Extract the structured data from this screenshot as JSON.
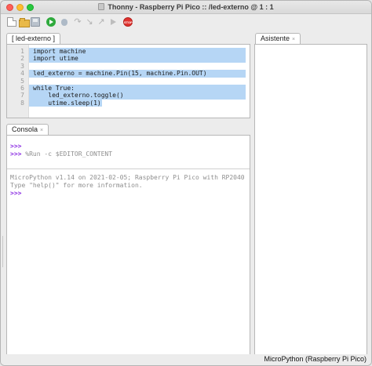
{
  "window": {
    "title": "Thonny  -  Raspberry Pi Pico :: /led-externo  @  1 : 1"
  },
  "toolbar": {
    "buttons": [
      {
        "name": "new",
        "icon": "new-file-icon"
      },
      {
        "name": "open",
        "icon": "open-folder-icon"
      },
      {
        "name": "save",
        "icon": "save-icon"
      },
      {
        "name": "run",
        "icon": "run-icon"
      },
      {
        "name": "debug",
        "icon": "debug-icon"
      },
      {
        "name": "step_over",
        "icon": "step-over-icon",
        "glyph": "↷"
      },
      {
        "name": "step_into",
        "icon": "step-into-icon",
        "glyph": "↘"
      },
      {
        "name": "step_out",
        "icon": "step-out-icon",
        "glyph": "↗"
      },
      {
        "name": "resume",
        "icon": "resume-icon"
      },
      {
        "name": "stop",
        "icon": "stop-icon"
      }
    ]
  },
  "editor": {
    "tab_label": "[ led-externo ]",
    "lines": [
      {
        "n": "1",
        "text": "import machine"
      },
      {
        "n": "2",
        "text": "import utime"
      },
      {
        "n": "3",
        "text": ""
      },
      {
        "n": "4",
        "text": "led_externo = machine.Pin(15, machine.Pin.OUT)"
      },
      {
        "n": "5",
        "text": ""
      },
      {
        "n": "6",
        "text": "while True:"
      },
      {
        "n": "7",
        "text": "    led_externo.toggle()"
      },
      {
        "n": "8",
        "text": "    utime.sleep(1)"
      }
    ]
  },
  "shell": {
    "tab_label": "Consola",
    "close_glyph": "×",
    "prompt": ">>>",
    "run_command": " %Run -c $EDITOR_CONTENT",
    "banner_line1": "MicroPython v1.14 on 2021-02-05; Raspberry Pi Pico with RP2040",
    "banner_line2": "Type \"help()\" for more information."
  },
  "assistant": {
    "tab_label": "Asistente",
    "close_glyph": "×"
  },
  "status": {
    "interpreter": "MicroPython (Raspberry Pi Pico)"
  },
  "colors": {
    "selection": "#b6d6f5",
    "prompt": "#8a2be2",
    "run_button": "#2faa3d",
    "stop_button": "#e0332f"
  }
}
